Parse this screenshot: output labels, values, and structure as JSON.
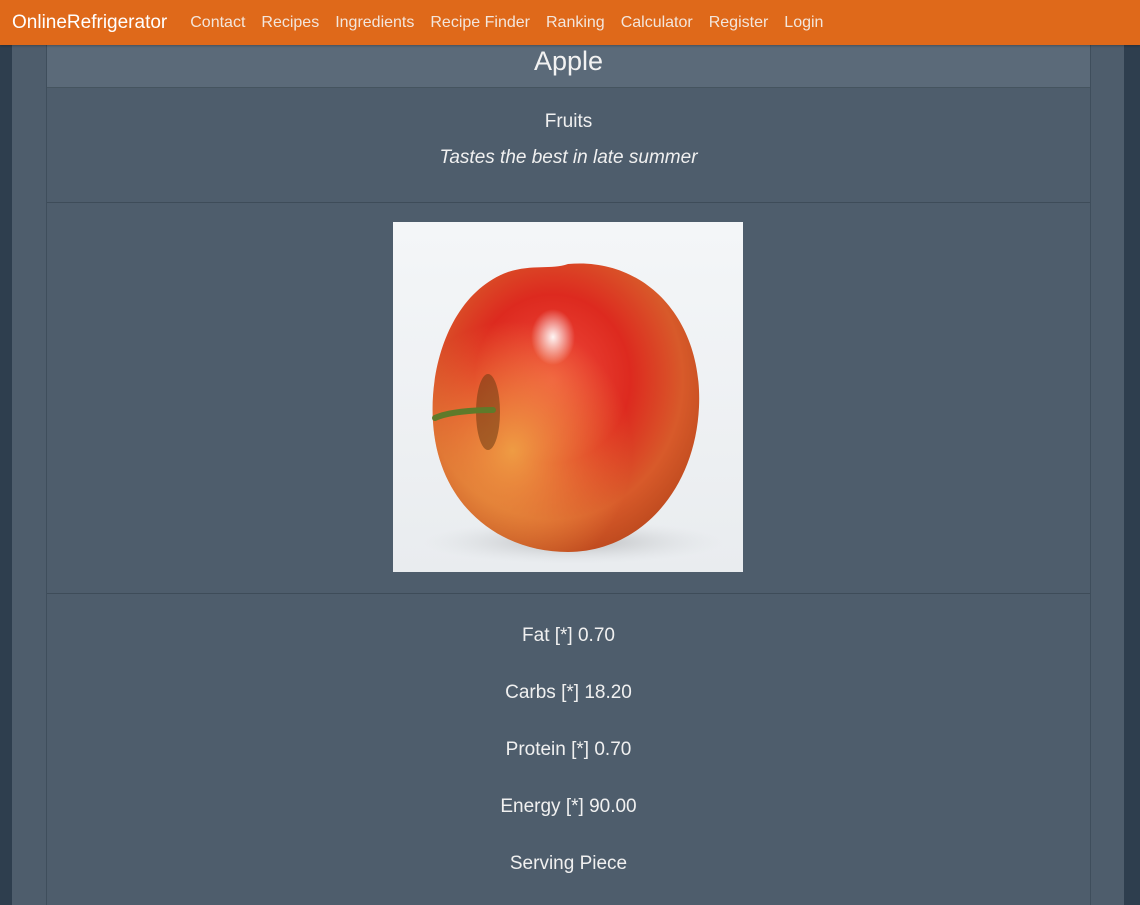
{
  "navbar": {
    "brand": "OnlineRefrigerator",
    "links": [
      "Contact",
      "Recipes",
      "Ingredients",
      "Recipe Finder",
      "Ranking",
      "Calculator",
      "Register",
      "Login"
    ]
  },
  "ingredient": {
    "name": "Apple",
    "category": "Fruits",
    "tagline": "Tastes the best in late summer",
    "image_subject": "red-apple-photo"
  },
  "nutrition": [
    "Fat [*] 0.70",
    "Carbs [*] 18.20",
    "Protein [*] 0.70",
    "Energy [*] 90.00",
    "Serving Piece"
  ],
  "colors": {
    "navbar": "#df691a",
    "background": "#2e3e4e",
    "card": "#4e5d6c",
    "card_header": "#5b6a79"
  }
}
